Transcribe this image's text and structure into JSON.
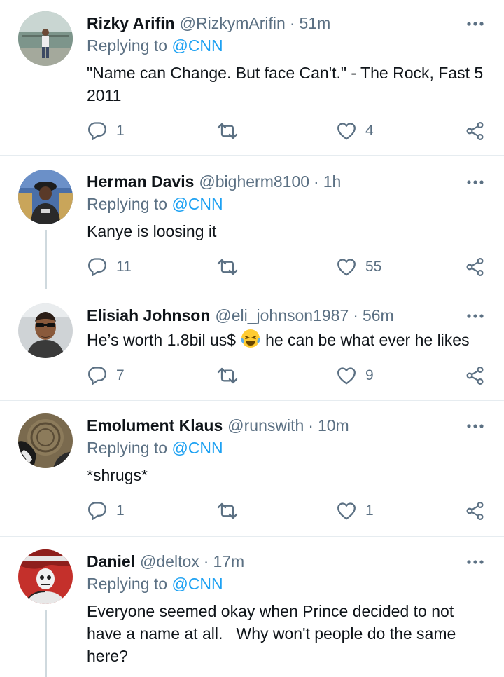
{
  "tweets": [
    {
      "name": "Rizky Arifin",
      "handle": "@RizkymArifin",
      "separator": "·",
      "time": "51m",
      "replying_prefix": "Replying to",
      "replying_to": "@CNN",
      "text": "\"Name can Change. But face Can't.\" - The Rock, Fast 5 2011",
      "replies": "1",
      "retweets": "",
      "likes": "4"
    },
    {
      "name": "Herman Davis",
      "handle": "@bigherm8100",
      "separator": "·",
      "time": "1h",
      "replying_prefix": "Replying to",
      "replying_to": "@CNN",
      "text": "Kanye is loosing it",
      "replies": "11",
      "retweets": "",
      "likes": "55"
    },
    {
      "name": "Elisiah Johnson",
      "handle": "@eli_johnson1987",
      "separator": "·",
      "time": "56m",
      "text_before_emoji": "He’s worth 1.8bil us$",
      "emoji": "face-with-tears-of-joy",
      "text_after_emoji": "he can be what ever he likes",
      "replies": "7",
      "retweets": "",
      "likes": "9"
    },
    {
      "name": "Emolument Klaus",
      "handle": "@runswith",
      "separator": "·",
      "time": "10m",
      "replying_prefix": "Replying to",
      "replying_to": "@CNN",
      "text": "*shrugs*",
      "replies": "1",
      "retweets": "",
      "likes": "1"
    },
    {
      "name": "Daniel",
      "handle": "@deltox",
      "separator": "·",
      "time": "17m",
      "replying_prefix": "Replying to",
      "replying_to": "@CNN",
      "text_lines": [
        "Everyone seemed okay when Prince decided to not",
        "have a name at all.   Why won't people do the same",
        "here?"
      ]
    }
  ],
  "icons": {
    "more": "more-horizontal-icon",
    "reply": "reply-icon",
    "retweet": "retweet-icon",
    "like": "heart-icon",
    "share": "share-icon"
  },
  "colors": {
    "text": "#0f1419",
    "secondary": "#5b7083",
    "link": "#1da1f2",
    "divider": "#e6ecf0",
    "thread_line": "#cfd9de"
  }
}
